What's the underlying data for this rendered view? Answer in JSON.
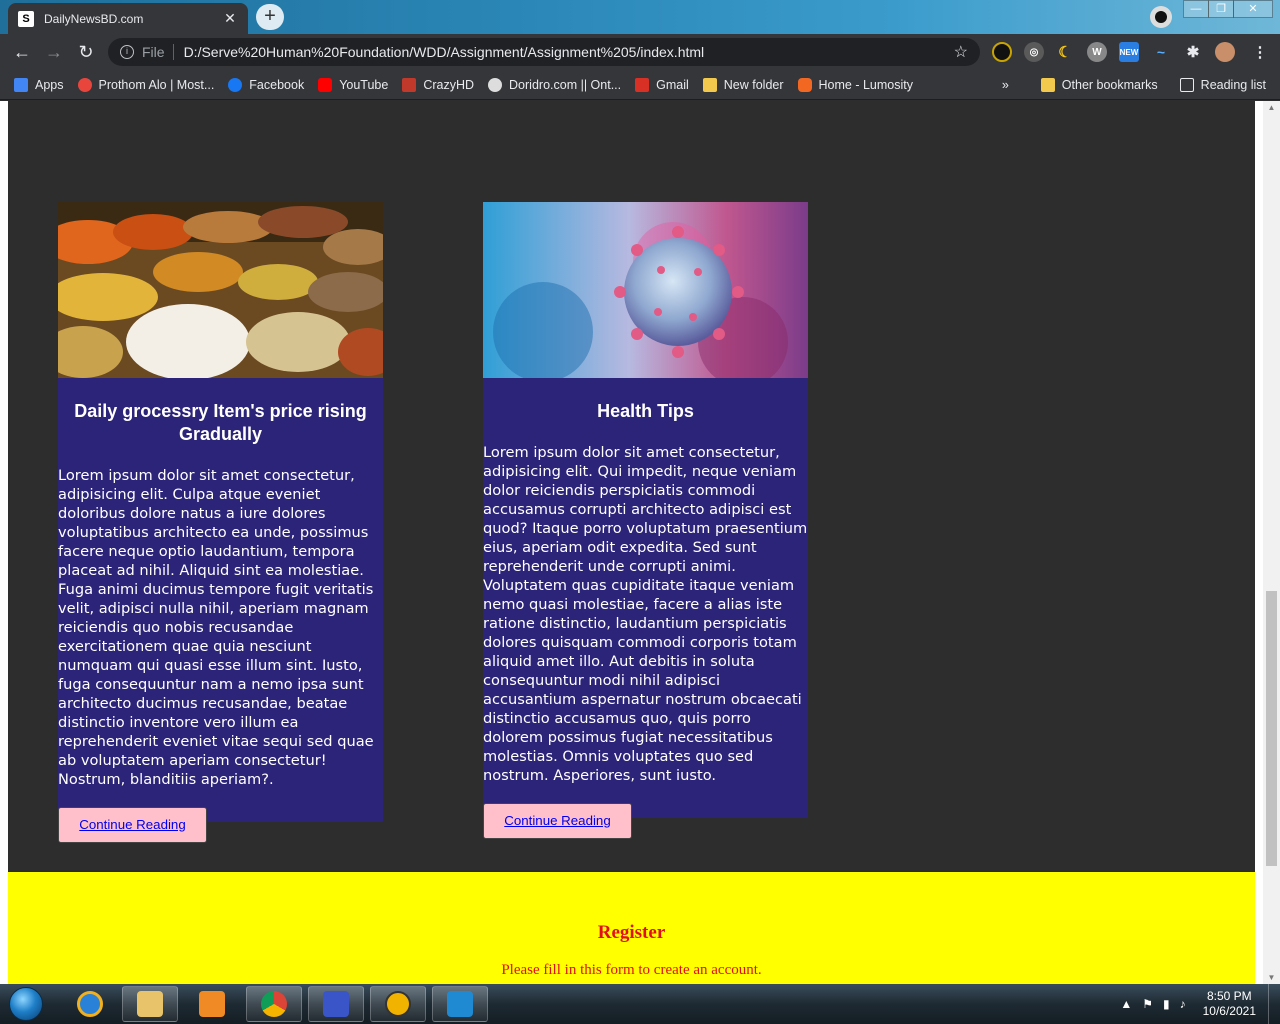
{
  "browser": {
    "tab_title": "DailyNewsBD.com",
    "tab_close": "✕",
    "new_tab": "+",
    "url_scheme": "File",
    "url": "D:/Serve%20Human%20Foundation/WDD/Assignment/Assignment%205/index.html",
    "bookmarks": [
      {
        "label": "Apps",
        "color": "#4285f4"
      },
      {
        "label": "Prothom Alo | Most...",
        "color": "#e8453c"
      },
      {
        "label": "Facebook",
        "color": "#1877f2"
      },
      {
        "label": "YouTube",
        "color": "#ff0000"
      },
      {
        "label": "CrazyHD",
        "color": "#c0392b"
      },
      {
        "label": "Doridro.com || Ont...",
        "color": "#dddddd"
      },
      {
        "label": "Gmail",
        "color": "#d93025"
      },
      {
        "label": "New folder",
        "color": "#f2c94c"
      },
      {
        "label": "Home - Lumosity",
        "color": "#f26722"
      }
    ],
    "overflow": "»",
    "other_bookmarks": "Other bookmarks",
    "reading_list": "Reading list"
  },
  "cards": [
    {
      "title": "Daily grocessry Item's price rising Gradually",
      "body": "Lorem ipsum dolor sit amet consectetur, adipisicing elit. Culpa atque eveniet doloribus dolore natus a iure dolores voluptatibus architecto ea unde, possimus facere neque optio laudantium, tempora placeat ad nihil. Aliquid sint ea molestiae. Fuga animi ducimus tempore fugit veritatis velit, adipisci nulla nihil, aperiam magnam reiciendis quo nobis recusandae exercitationem quae quia nesciunt numquam qui quasi esse illum sint. Iusto, fuga consequuntur nam a nemo ipsa sunt architecto ducimus recusandae, beatae distinctio inventore vero illum ea reprehenderit eveniet vitae sequi sed quae ab voluptatem aperiam consectetur! Nostrum, blanditiis aperiam?.",
      "button": "Continue Reading"
    },
    {
      "title": "Health Tips",
      "body": "Lorem ipsum dolor sit amet consectetur, adipisicing elit. Qui impedit, neque veniam dolor reiciendis perspiciatis commodi accusamus corrupti architecto adipisci est quod? Itaque porro voluptatum praesentium eius, aperiam odit expedita. Sed sunt reprehenderit unde corrupti animi. Voluptatem quas cupiditate itaque veniam nemo quasi molestiae, facere a alias iste ratione distinctio, laudantium perspiciatis dolores quisquam commodi corporis totam aliquid amet illo. Aut debitis in soluta consequuntur modi nihil adipisci accusantium aspernatur nostrum obcaecati distinctio accusamus quo, quis porro dolorem possimus fugiat necessitatibus molestias. Omnis voluptates quo sed nostrum. Asperiores, sunt iusto.",
      "button": "Continue Reading"
    }
  ],
  "register": {
    "title": "Register",
    "subtitle": "Please fill in this form to create an account."
  },
  "taskbar": {
    "time": "8:50 PM",
    "date": "10/6/2021"
  },
  "colors": {
    "card_bg": "#2b2478",
    "page_bg": "#2d2d2d",
    "footer_bg": "#ffff00",
    "button_bg": "#ffc0cb",
    "register_text": "#e0101a"
  }
}
